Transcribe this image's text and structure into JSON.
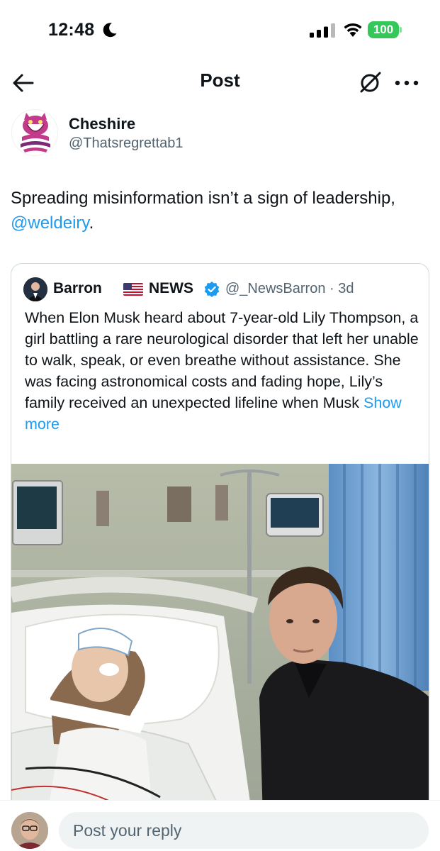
{
  "status_bar": {
    "time": "12:48",
    "battery": "100",
    "icons": [
      "moon-icon",
      "signal-icon",
      "wifi-icon",
      "battery-icon"
    ]
  },
  "header": {
    "title": "Post",
    "back_icon": "arrow-left-icon",
    "grok_icon": "grok-icon",
    "more_icon": "more-horizontal-icon"
  },
  "author": {
    "name": "Cheshire",
    "handle": "@Thatsregrettab1"
  },
  "post": {
    "text_before": "Spreading misinformation isn’t a sign of leadership, ",
    "mention": "@weldeiry",
    "text_after": "."
  },
  "quoted": {
    "name": "Barron",
    "name_suffix": "NEWS",
    "handle_time": "@_NewsBarron · 3d",
    "text": "When Elon Musk heard about 7-year-old Lily Thompson, a girl battling a rare neurological disorder that left her unable to walk, speak, or even breathe without assistance. She was facing astronomical costs and fading hope, Lily’s family received an unexpected lifeline when Musk ",
    "show_more": "Show more",
    "media_alt": "hospital-bed-photo"
  },
  "reply": {
    "placeholder": "Post your reply"
  },
  "colors": {
    "accent": "#1d9bf0",
    "text": "#0f1419",
    "muted": "#536471",
    "border": "#cfd9de",
    "battery": "#34c759"
  }
}
